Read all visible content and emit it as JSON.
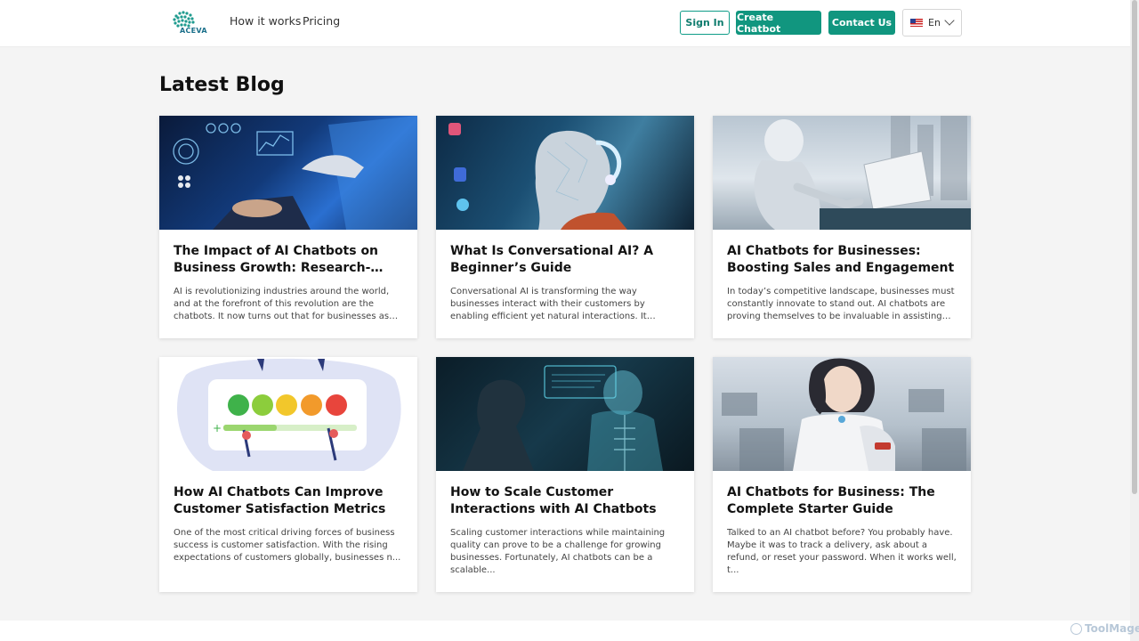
{
  "header": {
    "logo_text": "ACEVA",
    "nav": [
      "How it works",
      "Pricing"
    ],
    "sign_in": "Sign In",
    "create_chatbot": "Create Chatbot",
    "contact_us": "Contact Us",
    "language": "En",
    "flag_icon": "us-flag-icon",
    "chevron_icon": "chevron-down-icon"
  },
  "page_title": "Latest Blog",
  "posts": [
    {
      "title": "The Impact of AI Chatbots on Business Growth: Research-based Insights",
      "excerpt": "AI is revolutionizing industries around the world, and at the forefront of this revolution are the chatbots. It now turns out that for businesses as s...",
      "image": "robot-hand-laptop-image"
    },
    {
      "title": "What Is Conversational AI? A Beginner’s Guide",
      "excerpt": "Conversational AI is transforming the way businesses interact with their customers by enabling efficient yet natural interactions. It encompasses tech...",
      "image": "ai-head-headset-image"
    },
    {
      "title": "AI Chatbots for Businesses: Boosting Sales and Engagement",
      "excerpt": "In today’s competitive landscape, businesses must constantly innovate to stand out. AI chatbots are proving themselves to be invaluable in assisting b...",
      "image": "robot-typing-laptop-image"
    },
    {
      "title": "How AI Chatbots Can Improve Customer Satisfaction Metrics",
      "excerpt": "One of the most critical driving forces of business success is customer satisfaction. With the rising expectations of customers globally, businesses n...",
      "image": "satisfaction-faces-illustration"
    },
    {
      "title": "How to Scale Customer Interactions with AI Chatbots",
      "excerpt": "Scaling customer interactions while maintaining quality can prove to be a challenge for growing businesses. Fortunately, AI chatbots can be a scalable...",
      "image": "person-hologram-robot-image"
    },
    {
      "title": "AI Chatbots for Business: The Complete Starter Guide",
      "excerpt": "Talked to an AI chatbot before? You probably have. Maybe it was to track a delivery, ask about a refund, or reset your password. When it works well, t...",
      "image": "robot-call-center-image"
    }
  ],
  "watermark": "ToolMage"
}
